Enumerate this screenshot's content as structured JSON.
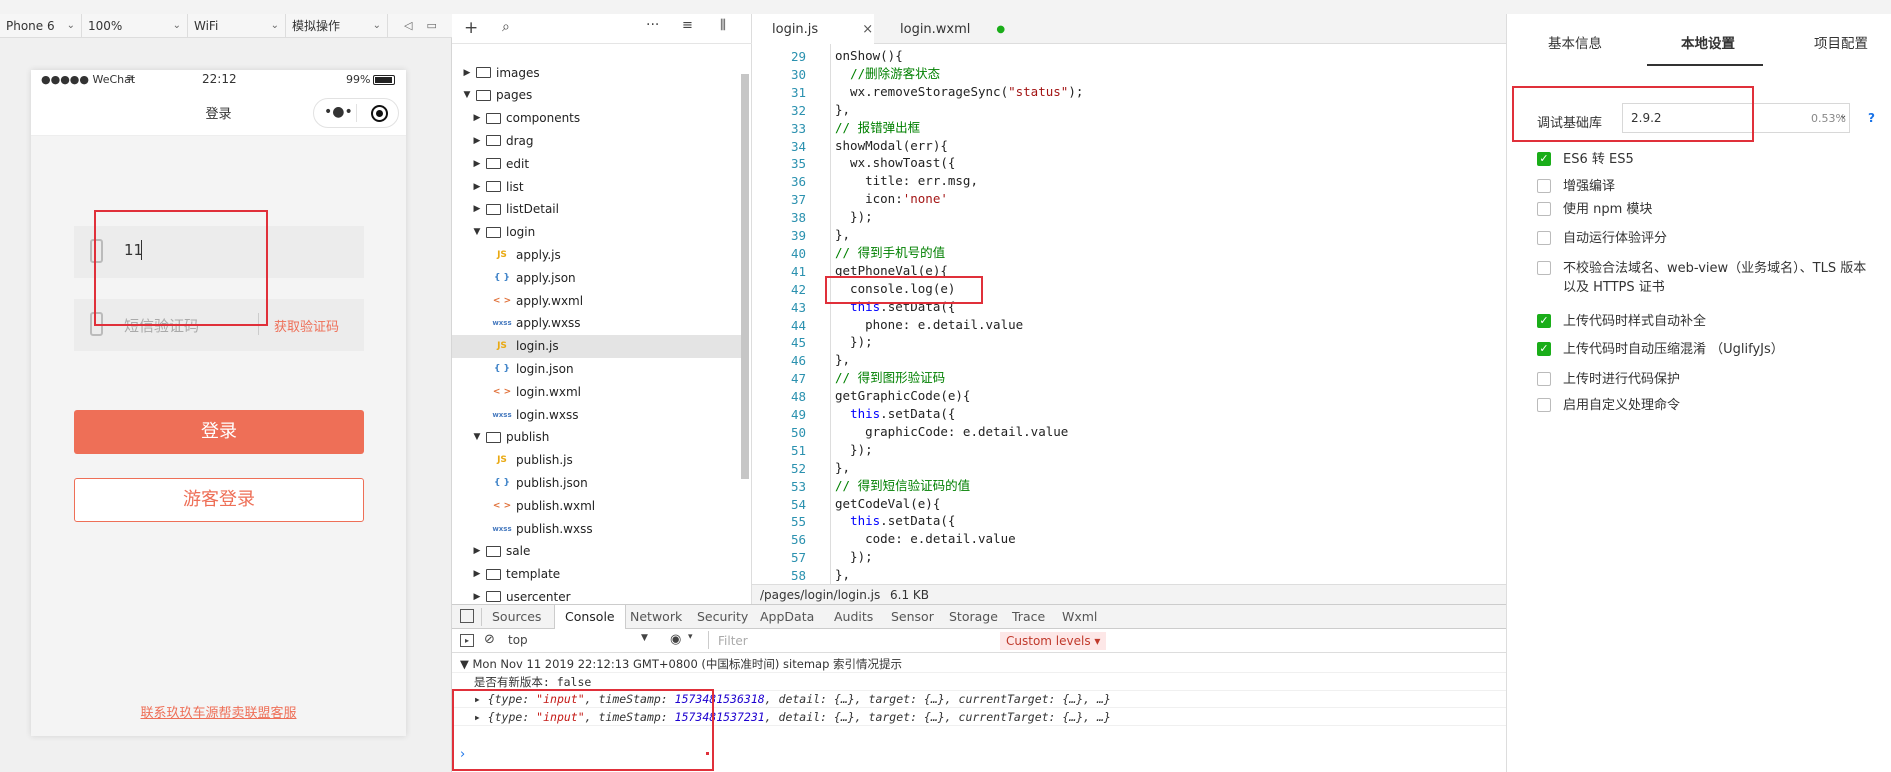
{
  "colors": {
    "accent": "#1aad19",
    "primary_button": "#ee6f57",
    "highlight": "#e0303a"
  },
  "simulator": {
    "device": "Phone 6",
    "zoom": "100%",
    "network": "WiFi",
    "operation": "模拟操作",
    "status_bar": {
      "signal": "●●●●● WeChat",
      "time": "22:12",
      "battery": "99%"
    },
    "nav_title": "登录",
    "login": {
      "phone_value": "11",
      "sms_placeholder": "短信验证码",
      "get_code_label": "获取验证码",
      "login_button": "登录",
      "guest_button": "游客登录",
      "footer_link": "联系玖玖车源帮卖联盟客服"
    }
  },
  "file_tree": {
    "rows": [
      {
        "label": "images",
        "type": "folder",
        "state": "collapsed",
        "level": 0
      },
      {
        "label": "pages",
        "type": "folder",
        "state": "expanded",
        "level": 0
      },
      {
        "label": "components",
        "type": "folder",
        "state": "collapsed",
        "level": 1
      },
      {
        "label": "drag",
        "type": "folder",
        "state": "collapsed",
        "level": 1
      },
      {
        "label": "edit",
        "type": "folder",
        "state": "collapsed",
        "level": 1
      },
      {
        "label": "list",
        "type": "folder",
        "state": "collapsed",
        "level": 1
      },
      {
        "label": "listDetail",
        "type": "folder",
        "state": "collapsed",
        "level": 1
      },
      {
        "label": "login",
        "type": "folder",
        "state": "expanded",
        "level": 1
      },
      {
        "label": "apply.js",
        "type": "js",
        "level": 2
      },
      {
        "label": "apply.json",
        "type": "json",
        "level": 2
      },
      {
        "label": "apply.wxml",
        "type": "wxml",
        "level": 2
      },
      {
        "label": "apply.wxss",
        "type": "wxss",
        "level": 2
      },
      {
        "label": "login.js",
        "type": "js",
        "level": 2,
        "selected": true
      },
      {
        "label": "login.json",
        "type": "json",
        "level": 2
      },
      {
        "label": "login.wxml",
        "type": "wxml",
        "level": 2
      },
      {
        "label": "login.wxss",
        "type": "wxss",
        "level": 2
      },
      {
        "label": "publish",
        "type": "folder",
        "state": "expanded",
        "level": 1
      },
      {
        "label": "publish.js",
        "type": "js",
        "level": 2
      },
      {
        "label": "publish.json",
        "type": "json",
        "level": 2
      },
      {
        "label": "publish.wxml",
        "type": "wxml",
        "level": 2
      },
      {
        "label": "publish.wxss",
        "type": "wxss",
        "level": 2
      },
      {
        "label": "sale",
        "type": "folder",
        "state": "collapsed",
        "level": 1
      },
      {
        "label": "template",
        "type": "folder",
        "state": "collapsed",
        "level": 1
      },
      {
        "label": "usercenter",
        "type": "folder",
        "state": "collapsed",
        "level": 1
      }
    ],
    "icon_labels": {
      "js": "JS",
      "json": "{ }",
      "wxml": "< >",
      "wxss": "wxss"
    }
  },
  "editor": {
    "tabs": [
      {
        "label": "login.js",
        "active": true,
        "close": "×"
      },
      {
        "label": "login.wxml",
        "active": false,
        "dot": "●"
      }
    ],
    "lines": [
      {
        "n": "29",
        "html": "onShow(){"
      },
      {
        "n": "30",
        "html": "  <span class='cm'>//删除游客状态</span>"
      },
      {
        "n": "31",
        "html": "  wx.removeStorageSync(<span class='str'>\"status\"</span>);"
      },
      {
        "n": "32",
        "html": "},"
      },
      {
        "n": "33",
        "html": "<span class='cm'>// 报错弹出框</span>"
      },
      {
        "n": "34",
        "html": "showModal(err){"
      },
      {
        "n": "35",
        "html": "  wx.showToast({"
      },
      {
        "n": "36",
        "html": "    title: err.msg,"
      },
      {
        "n": "37",
        "html": "    icon:<span class='str'>'none'</span>"
      },
      {
        "n": "38",
        "html": "  });"
      },
      {
        "n": "39",
        "html": "},"
      },
      {
        "n": "40",
        "html": "<span class='cm'>// 得到手机号的值</span>"
      },
      {
        "n": "41",
        "html": "getPhoneVal(e){"
      },
      {
        "n": "42",
        "html": "  console.log(e)"
      },
      {
        "n": "43",
        "html": "  <span class='kw'>this</span>.setData({"
      },
      {
        "n": "44",
        "html": "    phone: e.detail.value"
      },
      {
        "n": "45",
        "html": "  });"
      },
      {
        "n": "46",
        "html": "},"
      },
      {
        "n": "47",
        "html": "<span class='cm'>// 得到图形验证码</span>"
      },
      {
        "n": "48",
        "html": "getGraphicCode(e){"
      },
      {
        "n": "49",
        "html": "  <span class='kw'>this</span>.setData({"
      },
      {
        "n": "50",
        "html": "    graphicCode: e.detail.value"
      },
      {
        "n": "51",
        "html": "  });"
      },
      {
        "n": "52",
        "html": "},"
      },
      {
        "n": "53",
        "html": "<span class='cm'>// 得到短信验证码的值</span>"
      },
      {
        "n": "54",
        "html": "getCodeVal(e){"
      },
      {
        "n": "55",
        "html": "  <span class='kw'>this</span>.setData({"
      },
      {
        "n": "56",
        "html": "    code: e.detail.value"
      },
      {
        "n": "57",
        "html": "  });"
      },
      {
        "n": "58",
        "html": "},"
      }
    ],
    "status_path": "/pages/login/login.js",
    "status_size": "6.1 KB"
  },
  "console": {
    "tabs": [
      "Sources",
      "Console",
      "Network",
      "Security",
      "AppData",
      "Audits",
      "Sensor",
      "Storage",
      "Trace",
      "Wxml"
    ],
    "active_tab": "Console",
    "context": "top",
    "filter_placeholder": "Filter",
    "levels": "Custom levels ▾",
    "messages": [
      {
        "text": "▼ Mon Nov 11 2019 22:12:13 GMT+0800 (中国标准时间) sitemap 索引情况提示"
      },
      {
        "text": "  是否有新版本: false"
      },
      {
        "html": "  ▸ <span class='it'>{type: <span class='sv'>\"input\"</span>, timeStamp: <span class='num'>1573481536318</span>, detail: {…}, target: {…}, currentTarget: {…}, …}</span>"
      },
      {
        "html": "  ▸ <span class='it'>{type: <span class='sv'>\"input\"</span>, timeStamp: <span class='num'>1573481537231</span>, detail: {…}, target: {…}, currentTarget: {…}, …}</span>"
      }
    ],
    "prompt": "›"
  },
  "settings": {
    "tabs": [
      "基本信息",
      "本地设置",
      "项目配置"
    ],
    "active_tab": "本地设置",
    "debug_lib_label": "调试基础库",
    "debug_lib_version": "2.9.2",
    "debug_lib_pct": "0.53%",
    "help": "?",
    "options": [
      {
        "label": "ES6 转 ES5",
        "checked": true
      },
      {
        "label": "增强编译",
        "checked": false
      },
      {
        "label": "使用 npm 模块",
        "checked": false
      },
      {
        "label": "自动运行体验评分",
        "checked": false
      },
      {
        "label": "不校验合法域名、web-view（业务域名）、TLS 版本以及 HTTPS 证书",
        "checked": false
      },
      {
        "label": "上传代码时样式自动补全",
        "checked": true
      },
      {
        "label": "上传代码时自动压缩混淆 （UglifyJs）",
        "checked": true
      },
      {
        "label": "上传时进行代码保护",
        "checked": false
      },
      {
        "label": "启用自定义处理命令",
        "checked": false
      }
    ]
  }
}
